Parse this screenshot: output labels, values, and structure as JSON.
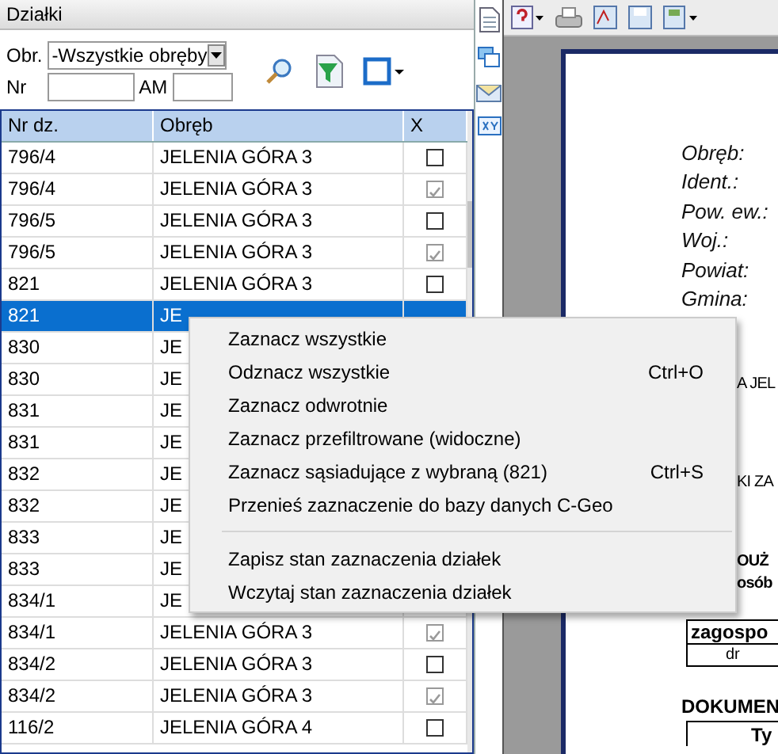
{
  "panel": {
    "title": "Działki"
  },
  "filters": {
    "obr_label": "Obr.",
    "obr_value": "-Wszystkie obręby",
    "nr_label": "Nr",
    "am_label": "AM"
  },
  "table": {
    "columns": [
      "Nr dz.",
      "Obręb",
      "X"
    ],
    "rows": [
      {
        "nr": "796/4",
        "obreb": "JELENIA GÓRA 3",
        "checked": false,
        "selected": false
      },
      {
        "nr": "796/4",
        "obreb": "JELENIA GÓRA 3",
        "checked": true,
        "selected": false
      },
      {
        "nr": "796/5",
        "obreb": "JELENIA GÓRA 3",
        "checked": false,
        "selected": false
      },
      {
        "nr": "796/5",
        "obreb": "JELENIA GÓRA 3",
        "checked": true,
        "selected": false
      },
      {
        "nr": "821",
        "obreb": "JELENIA GÓRA 3",
        "checked": false,
        "selected": false
      },
      {
        "nr": "821",
        "obreb": "JE",
        "selected": true
      },
      {
        "nr": "830",
        "obreb": "JE",
        "selected": false
      },
      {
        "nr": "830",
        "obreb": "JE",
        "selected": false
      },
      {
        "nr": "831",
        "obreb": "JE",
        "selected": false
      },
      {
        "nr": "831",
        "obreb": "JE",
        "selected": false
      },
      {
        "nr": "832",
        "obreb": "JE",
        "selected": false
      },
      {
        "nr": "832",
        "obreb": "JE",
        "selected": false
      },
      {
        "nr": "833",
        "obreb": "JE",
        "selected": false
      },
      {
        "nr": "833",
        "obreb": "JE",
        "selected": false
      },
      {
        "nr": "834/1",
        "obreb": "JE",
        "selected": false
      },
      {
        "nr": "834/1",
        "obreb": "JELENIA GÓRA 3",
        "checked": true,
        "selected": false
      },
      {
        "nr": "834/2",
        "obreb": "JELENIA GÓRA 3",
        "checked": false,
        "selected": false
      },
      {
        "nr": "834/2",
        "obreb": "JELENIA GÓRA 3",
        "checked": true,
        "selected": false
      },
      {
        "nr": "116/2",
        "obreb": "JELENIA GÓRA 4",
        "checked": false,
        "selected": false
      }
    ]
  },
  "document": {
    "labels": [
      "Obręb:",
      "Ident.:",
      "Pow. ew.:",
      "Woj.:",
      "Powiat:",
      "Gmina:"
    ],
    "fragment_1": "A JEL",
    "fragment_2": "KI ZA",
    "fragment_3": "OUŻ",
    "fragment_4": "osób",
    "fragment_5": "zagospo",
    "cell": "dr",
    "heading": "DOKUMEN",
    "column_1": "Ty"
  },
  "context_menu": [
    {
      "kind": "item",
      "label": "Zaznacz wszystkie"
    },
    {
      "kind": "item",
      "label": "Odznacz wszystkie",
      "shortcut": "Ctrl+O"
    },
    {
      "kind": "item",
      "label": "Zaznacz odwrotnie"
    },
    {
      "kind": "item",
      "label": "Zaznacz przefiltrowane (widoczne)"
    },
    {
      "kind": "item",
      "label": "Zaznacz sąsiadujące z wybraną (821)",
      "shortcut": "Ctrl+S"
    },
    {
      "kind": "item",
      "label": "Przenieś zaznaczenie do bazy danych C-Geo"
    },
    {
      "kind": "separator"
    },
    {
      "kind": "item",
      "label": "Zapisz stan zaznaczenia działek"
    },
    {
      "kind": "item",
      "label": "Wczytaj stan zaznaczenia działek"
    }
  ]
}
